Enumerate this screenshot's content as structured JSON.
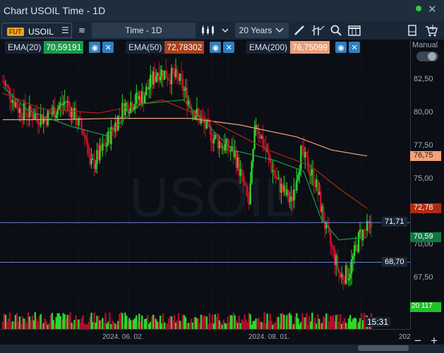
{
  "window": {
    "title": "Chart USOIL Time - 1D",
    "status_color": "#2ecc40"
  },
  "toolbar": {
    "fut_badge": "FUT",
    "symbol": "USOIL",
    "timeframe": "Time - 1D",
    "range": "20 Years",
    "icons": [
      "list-icon",
      "compare-icon",
      "candle-type-icon",
      "pencil-icon",
      "indicator-icon",
      "search-icon",
      "layout-icon",
      "save-icon",
      "basket-icon"
    ]
  },
  "indicators": [
    {
      "label": "EMA(20)",
      "value": "70,59191",
      "color": "#1a9a4a"
    },
    {
      "label": "EMA(50)",
      "value": "72,78302",
      "color": "#a8421c"
    },
    {
      "label": "EMA(200)",
      "value": "76,75099",
      "color": "#e8a07a"
    }
  ],
  "right_panel": {
    "mode": "Manual"
  },
  "chart_data": {
    "type": "candlestick",
    "watermark": "USOIL",
    "y_ticks": [
      "82,50",
      "80,00",
      "77,50",
      "75,00",
      "72,50",
      "70,00",
      "67,50"
    ],
    "ylim": [
      66.0,
      84.5
    ],
    "x_ticks": [
      "2024. 06. 02.",
      "2024. 08. 01.",
      "202"
    ],
    "price_labels": [
      {
        "name": "EMA(200)",
        "value": "76,75",
        "color": "#f5a07a"
      },
      {
        "name": "EMA(50)",
        "value": "72,78",
        "color": "#b02a10"
      },
      {
        "name": "EMA(20)",
        "value": "70,59",
        "color": "#0f7a40"
      }
    ],
    "horizontal_lines": [
      "71,71",
      "68,70"
    ],
    "volume_label": "20 117",
    "time_label": "15:31"
  }
}
